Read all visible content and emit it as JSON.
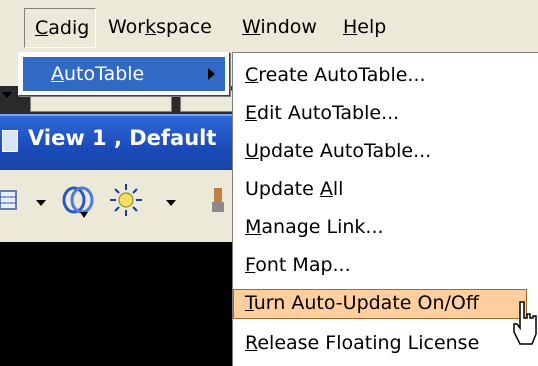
{
  "menubar": {
    "items": [
      {
        "pre": "",
        "ul": "C",
        "post": "adig"
      },
      {
        "pre": "Wor",
        "ul": "k",
        "post": "space"
      },
      {
        "pre": "",
        "ul": "W",
        "post": "indow"
      },
      {
        "pre": "",
        "ul": "H",
        "post": "elp"
      }
    ]
  },
  "submenu": {
    "item": {
      "pre": "",
      "ul": "A",
      "post": "utoTable"
    }
  },
  "dropdown": {
    "items": [
      {
        "pre": "",
        "ul": "C",
        "post": "reate AutoTable..."
      },
      {
        "pre": "",
        "ul": "E",
        "post": "dit AutoTable..."
      },
      {
        "pre": "",
        "ul": "U",
        "post": "pdate AutoTable..."
      },
      {
        "pre": "Update ",
        "ul": "A",
        "post": "ll"
      },
      {
        "pre": "",
        "ul": "M",
        "post": "anage Link..."
      },
      {
        "pre": "",
        "ul": "F",
        "post": "ont Map..."
      },
      {
        "pre": "",
        "ul": "T",
        "post": "urn Auto-Update On/Off"
      },
      {
        "pre": "",
        "ul": "R",
        "post": "elease Floating License"
      }
    ]
  },
  "view": {
    "title": "View 1 , Default"
  },
  "colors": {
    "menu_bg": "#ece9d8",
    "selection": "#316ac5",
    "hover_highlight": "#ffce9e",
    "title_bar": "#1a4bb8"
  }
}
